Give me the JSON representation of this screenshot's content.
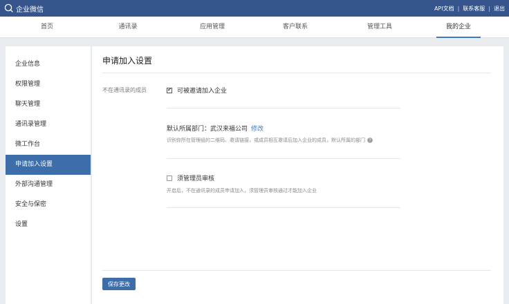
{
  "topbar": {
    "brand": "企业微信",
    "links": [
      "API文档",
      "联系客服",
      "退出"
    ],
    "separator": "|"
  },
  "nav": {
    "items": [
      "首页",
      "通讯录",
      "应用管理",
      "客户联系",
      "管理工具",
      "我的企业"
    ],
    "active_index": 5
  },
  "sidebar": {
    "items": [
      "企业信息",
      "权限管理",
      "聊天管理",
      "通讯录管理",
      "微工作台",
      "申请加入设置",
      "外部沟通管理",
      "安全与保密",
      "设置"
    ],
    "active_index": 5
  },
  "main": {
    "title": "申请加入设置",
    "row_label": "不在通讯录的成员",
    "invite_option": {
      "label": "可被邀请加入企业",
      "checked": true
    },
    "default_dept": {
      "label": "默认所属部门：武汉来福公司",
      "edit": "修改"
    },
    "dept_hint": "识别你所在管理组的二维码、邀请链接，或成员相互邀请后加入企业的成员，默认所属的部门",
    "review_option": {
      "label": "须管理员审核",
      "checked": false
    },
    "review_hint": "开启后，不在通讯录的成员申请加入，须管理员审核通过才能加入企业",
    "save_label": "保存更改"
  },
  "colors": {
    "topbar": "#36558c",
    "accent": "#3d6ea9",
    "link": "#3b78c7"
  }
}
